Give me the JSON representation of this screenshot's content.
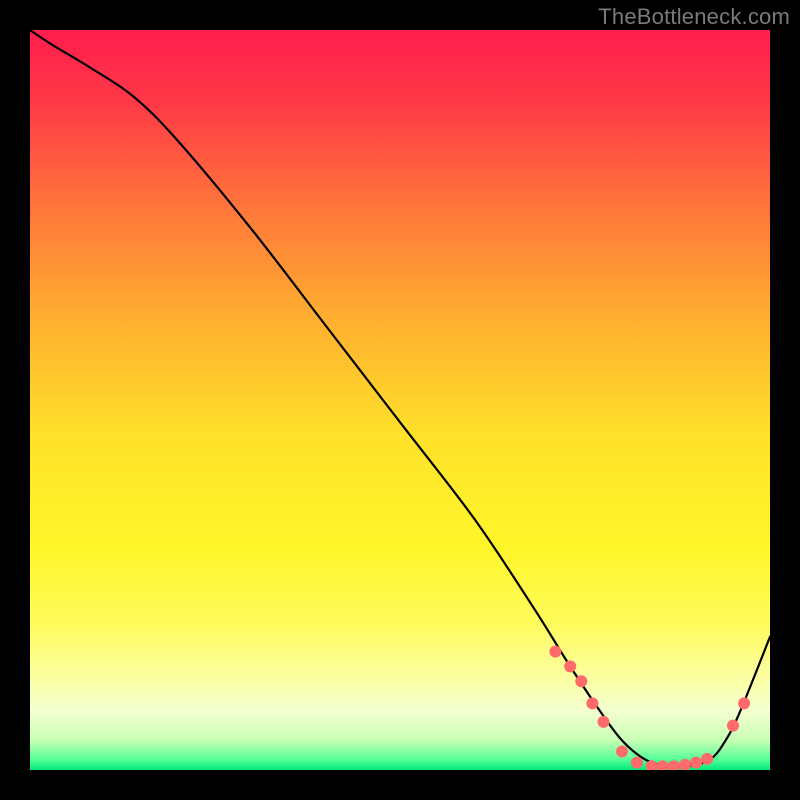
{
  "watermark": "TheBottleneck.com",
  "chart_data": {
    "type": "line",
    "title": "",
    "xlabel": "",
    "ylabel": "",
    "xlim": [
      0,
      100
    ],
    "ylim": [
      0,
      100
    ],
    "grid": false,
    "legend": false,
    "gradient_stops": [
      {
        "offset": 0.0,
        "color": "#ff1d4d"
      },
      {
        "offset": 0.1,
        "color": "#ff3a46"
      },
      {
        "offset": 0.25,
        "color": "#ff7a3a"
      },
      {
        "offset": 0.4,
        "color": "#ffb22f"
      },
      {
        "offset": 0.55,
        "color": "#ffe22a"
      },
      {
        "offset": 0.7,
        "color": "#fff62a"
      },
      {
        "offset": 0.8,
        "color": "#fffb5a"
      },
      {
        "offset": 0.88,
        "color": "#fbffa6"
      },
      {
        "offset": 0.92,
        "color": "#f4ffd0"
      },
      {
        "offset": 0.96,
        "color": "#c8ffb4"
      },
      {
        "offset": 0.985,
        "color": "#59ff9a"
      },
      {
        "offset": 1.0,
        "color": "#00e878"
      }
    ],
    "series": [
      {
        "name": "bottleneck-curve",
        "x": [
          0,
          3,
          8,
          14,
          20,
          30,
          40,
          50,
          60,
          68,
          73,
          77,
          80,
          83,
          86,
          89,
          92,
          94,
          96,
          100
        ],
        "y": [
          100,
          98,
          95,
          91,
          85,
          73,
          60,
          47,
          34,
          22,
          14,
          8,
          4,
          1.5,
          0.5,
          0.5,
          1.5,
          4,
          8,
          18
        ]
      }
    ],
    "markers": {
      "name": "highlight-points",
      "color": "#ff6b6b",
      "radius": 6,
      "points": [
        {
          "x": 71,
          "y": 16
        },
        {
          "x": 73,
          "y": 14
        },
        {
          "x": 74.5,
          "y": 12
        },
        {
          "x": 76,
          "y": 9
        },
        {
          "x": 77.5,
          "y": 6.5
        },
        {
          "x": 80,
          "y": 2.5
        },
        {
          "x": 82,
          "y": 1
        },
        {
          "x": 84,
          "y": 0.5
        },
        {
          "x": 85.5,
          "y": 0.5
        },
        {
          "x": 87,
          "y": 0.5
        },
        {
          "x": 88.5,
          "y": 0.7
        },
        {
          "x": 90,
          "y": 1
        },
        {
          "x": 91.5,
          "y": 1.5
        },
        {
          "x": 95,
          "y": 6
        },
        {
          "x": 96.5,
          "y": 9
        }
      ]
    }
  }
}
